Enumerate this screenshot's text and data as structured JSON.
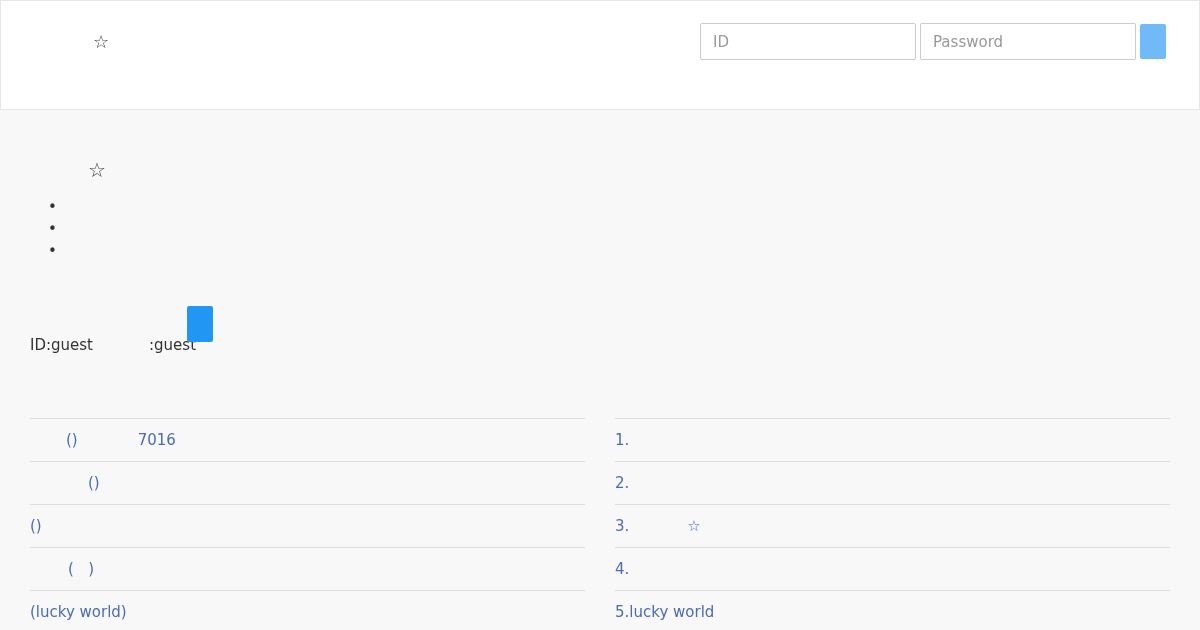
{
  "header": {
    "logo_text": "☆",
    "login": {
      "id_placeholder": "ID",
      "password_placeholder": "Password"
    }
  },
  "main": {
    "title": "☆",
    "bullets": [
      "•",
      "•",
      "•"
    ],
    "credentials": [
      {
        "text": "ID:guest"
      },
      {
        "text": ":guest"
      }
    ]
  },
  "left_list": [
    {
      "segments": [
        "()",
        "7016"
      ]
    },
    {
      "segments": [
        "()"
      ]
    },
    {
      "segments": [
        "()"
      ]
    },
    {
      "segments": [
        "(   )"
      ]
    },
    {
      "segments": [
        "(lucky world)"
      ]
    }
  ],
  "right_list": [
    {
      "segments": [
        "1."
      ]
    },
    {
      "segments": [
        "2."
      ]
    },
    {
      "segments": [
        "3.",
        "☆"
      ]
    },
    {
      "segments": [
        "4."
      ]
    },
    {
      "segments": [
        "5.lucky world"
      ]
    }
  ]
}
